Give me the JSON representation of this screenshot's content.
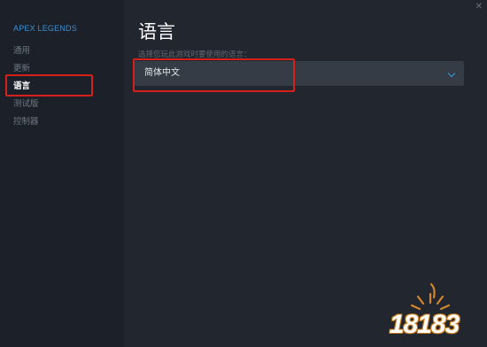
{
  "sidebar": {
    "app_title": "APEX LEGENDS",
    "items": [
      {
        "label": "通用"
      },
      {
        "label": "更新"
      },
      {
        "label": "语言",
        "active": true
      },
      {
        "label": "测试版"
      },
      {
        "label": "控制器"
      }
    ]
  },
  "main": {
    "title": "语言",
    "subtitle": "选择您玩此游戏时要使用的语言：",
    "language_select": {
      "selected": "简体中文",
      "icon": "chevron-down-icon",
      "accent_color": "#3d9be0"
    }
  },
  "window": {
    "close_glyph": "✕"
  },
  "annotation": {
    "highlight_color": "#d8201a"
  },
  "watermark": {
    "text": "18183"
  }
}
